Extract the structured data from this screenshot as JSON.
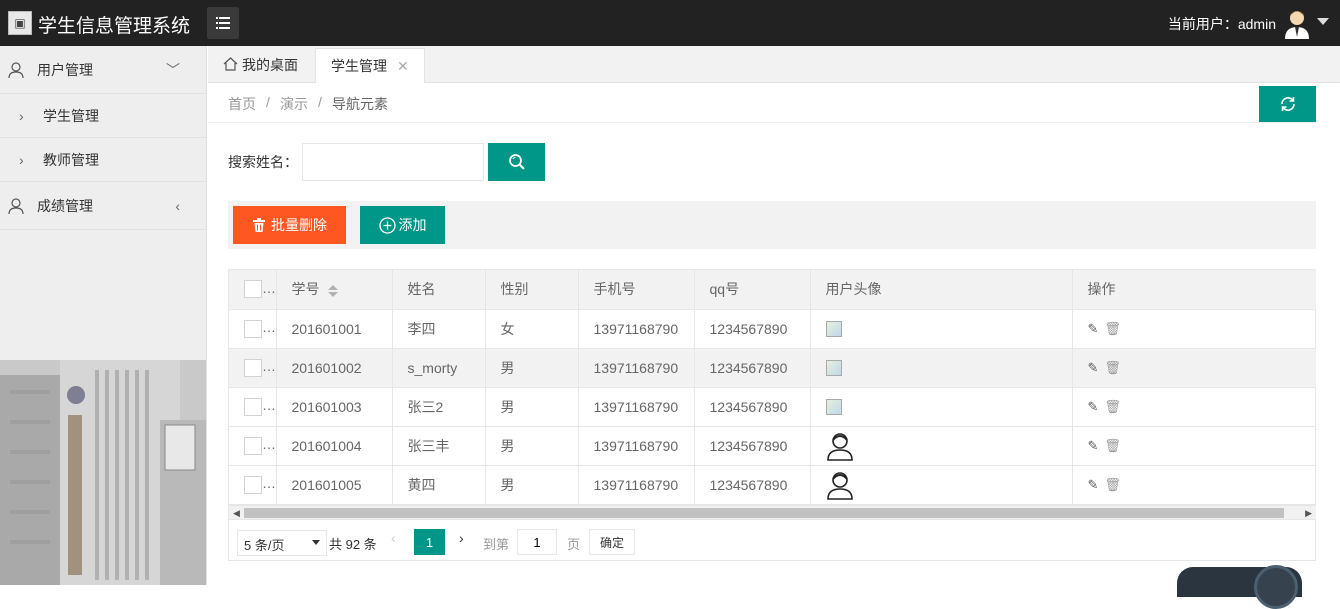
{
  "header": {
    "title": "学生信息管理系统",
    "user_label": "当前用户：admin"
  },
  "sidebar": {
    "groups": [
      {
        "label": "用户管理",
        "items": [
          {
            "label": "学生管理"
          },
          {
            "label": "教师管理"
          }
        ]
      },
      {
        "label": "成绩管理"
      }
    ]
  },
  "tabs": [
    {
      "label": "我的桌面"
    },
    {
      "label": "学生管理",
      "close": "✕"
    }
  ],
  "breadcrumb": [
    "首页",
    "/",
    "演示",
    "/",
    "导航元素"
  ],
  "search": {
    "label": "搜索姓名：",
    "value": "",
    "placeholder": ""
  },
  "toolbar": {
    "delete_label": "批量删除",
    "add_label": "添加"
  },
  "table": {
    "columns": [
      "学号",
      "姓名",
      "性别",
      "手机号",
      "qq号",
      "用户头像",
      "操作"
    ],
    "rows": [
      {
        "id": "201601001",
        "name": "李四",
        "gender": "女",
        "phone": "13971168790",
        "qq": "1234567890",
        "avatar": "broken"
      },
      {
        "id": "201601002",
        "name": "s_morty",
        "gender": "男",
        "phone": "13971168790",
        "qq": "1234567890",
        "avatar": "broken"
      },
      {
        "id": "201601003",
        "name": "张三2",
        "gender": "男",
        "phone": "13971168790",
        "qq": "1234567890",
        "avatar": "broken"
      },
      {
        "id": "201601004",
        "name": "张三丰",
        "gender": "男",
        "phone": "13971168790",
        "qq": "1234567890",
        "avatar": "person"
      },
      {
        "id": "201601005",
        "name": "黄四",
        "gender": "男",
        "phone": "13971168790",
        "qq": "1234567890",
        "avatar": "person"
      }
    ]
  },
  "pagination": {
    "page_size": "5 条/页",
    "total": "共 92 条",
    "current": "1",
    "goto_label": "到第",
    "goto_value": "1",
    "page_label": "页",
    "confirm_label": "确定"
  },
  "colors": {
    "primary": "#009688",
    "danger": "#ff5722",
    "header_bg": "#222222"
  },
  "icons": [
    "menu-icon",
    "home-icon",
    "refresh-icon",
    "search-icon",
    "trash-icon",
    "plus-circle-icon",
    "user-icon",
    "edit-icon",
    "sort-icon"
  ]
}
